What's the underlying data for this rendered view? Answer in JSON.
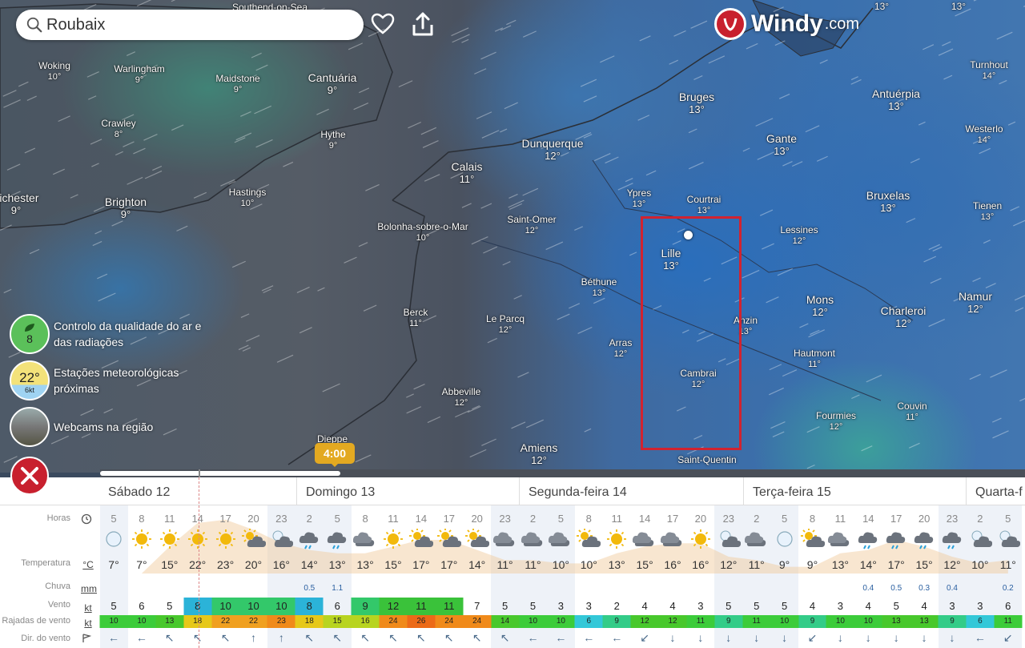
{
  "search": {
    "value": "Roubaix"
  },
  "logo": {
    "name": "Windy",
    "domain": ".com"
  },
  "cities": [
    {
      "name": "Southend-on-Sea",
      "temp": ""
    },
    {
      "name": "Woking",
      "temp": "10°"
    },
    {
      "name": "Warlingham",
      "temp": "9°"
    },
    {
      "name": "Maidstone",
      "temp": "9°"
    },
    {
      "name": "Cantuária",
      "temp": "9°"
    },
    {
      "name": "Crawley",
      "temp": "8°"
    },
    {
      "name": "Hythe",
      "temp": "9°"
    },
    {
      "name": "nichester",
      "temp": "9°"
    },
    {
      "name": "Brighton",
      "temp": "9°"
    },
    {
      "name": "Hastings",
      "temp": "10°"
    },
    {
      "name": "Calais",
      "temp": "11°"
    },
    {
      "name": "Dunquerque",
      "temp": "12°"
    },
    {
      "name": "Bolonha-sobre-o-Mar",
      "temp": "10°"
    },
    {
      "name": "Saint-Omer",
      "temp": "12°"
    },
    {
      "name": "Ypres",
      "temp": "13°"
    },
    {
      "name": "Courtrai",
      "temp": "13°"
    },
    {
      "name": "Bruges",
      "temp": "13°"
    },
    {
      "name": "Gante",
      "temp": "13°"
    },
    {
      "name": "Antuérpia",
      "temp": "13°"
    },
    {
      "name": "Turnhout",
      "temp": "14°"
    },
    {
      "name": "Westerlo",
      "temp": "14°"
    },
    {
      "name": "Bruxelas",
      "temp": "13°"
    },
    {
      "name": "Tienen",
      "temp": "13°"
    },
    {
      "name": "Lessines",
      "temp": "12°"
    },
    {
      "name": "Lille",
      "temp": "13°"
    },
    {
      "name": "Béthune",
      "temp": "13°"
    },
    {
      "name": "Mons",
      "temp": "12°"
    },
    {
      "name": "Charleroi",
      "temp": "12°"
    },
    {
      "name": "Namur",
      "temp": "12°"
    },
    {
      "name": "Berck",
      "temp": "11°"
    },
    {
      "name": "Le Parcq",
      "temp": "12°"
    },
    {
      "name": "Arras",
      "temp": "12°"
    },
    {
      "name": "Anzin",
      "temp": "13°"
    },
    {
      "name": "Hautmont",
      "temp": "11°"
    },
    {
      "name": "Cambrai",
      "temp": "12°"
    },
    {
      "name": "Abbeville",
      "temp": "12°"
    },
    {
      "name": "Fourmies",
      "temp": "12°"
    },
    {
      "name": "Couvin",
      "temp": "11°"
    },
    {
      "name": "Amiens",
      "temp": "12°"
    },
    {
      "name": "Dieppe",
      "temp": ""
    },
    {
      "name": "Saint-Quentin",
      "temp": ""
    },
    {
      "name": "13°",
      "temp": ""
    },
    {
      "name": "13°",
      "temp": ""
    }
  ],
  "sidebar": {
    "air_quality": {
      "value": "8",
      "label": "Controlo da qualidade do ar e das radiações"
    },
    "stations": {
      "value": "22°",
      "sub": "6kt",
      "label": "Estações meteorológicas próximas"
    },
    "webcams": {
      "label": "Webcams na região"
    }
  },
  "timeline": {
    "current_time": "4:00",
    "progress": 0.26
  },
  "colors": {
    "accent": "#c8202e",
    "time_bubble": "#e3a921",
    "selection": "#d12330"
  },
  "forecast": {
    "days": [
      "Sábado 12",
      "Domingo 13",
      "Segunda-feira 14",
      "Terça-feira 15",
      "Quarta-f"
    ],
    "labels": {
      "hours": "Horas",
      "temperature": "Temperatura",
      "rain": "Chuva",
      "wind": "Vento",
      "gusts": "Rajadas de vento",
      "direction": "Dir. do vento"
    },
    "units": {
      "temperature": "°C",
      "rain": "mm",
      "wind": "kt",
      "gusts": "kt"
    },
    "hours": [
      "5",
      "8",
      "11",
      "14",
      "17",
      "20",
      "23",
      "2",
      "5",
      "8",
      "11",
      "14",
      "17",
      "20",
      "23",
      "2",
      "5",
      "8",
      "11",
      "14",
      "17",
      "20",
      "23",
      "2",
      "5",
      "8",
      "11",
      "14",
      "17",
      "20",
      "23",
      "2",
      "5"
    ],
    "icons": [
      "moon",
      "sun",
      "sun",
      "sun",
      "sun",
      "sun-cloud",
      "moon-cloud",
      "cloud-rain",
      "cloud-rain",
      "cloud",
      "sun",
      "sun-cloud",
      "sun-cloud",
      "sun-cloud",
      "cloud",
      "cloud",
      "cloud",
      "sun-cloud",
      "sun",
      "cloud",
      "cloud",
      "sun",
      "moon-cloud",
      "cloud",
      "moon",
      "sun-cloud",
      "cloud",
      "cloud-rain",
      "cloud-rain",
      "cloud-rain",
      "cloud-rain",
      "moon-cloud",
      "moon-cloud"
    ],
    "temps": [
      "7°",
      "7°",
      "15°",
      "22°",
      "23°",
      "20°",
      "16°",
      "14°",
      "13°",
      "13°",
      "15°",
      "17°",
      "17°",
      "14°",
      "11°",
      "11°",
      "10°",
      "10°",
      "13°",
      "15°",
      "16°",
      "16°",
      "12°",
      "11°",
      "9°",
      "9°",
      "13°",
      "14°",
      "17°",
      "15°",
      "12°",
      "10°",
      "11°"
    ],
    "rain": [
      "",
      "",
      "",
      "",
      "",
      "",
      "",
      "0.5",
      "1.1",
      "",
      "",
      "",
      "",
      "",
      "",
      "",
      "",
      "",
      "",
      "",
      "",
      "",
      "",
      "",
      "",
      "",
      "",
      "0.4",
      "0.5",
      "0.3",
      "0.4",
      "",
      "0.2"
    ],
    "wind": [
      "5",
      "6",
      "5",
      "8",
      "10",
      "10",
      "10",
      "8",
      "6",
      "9",
      "12",
      "11",
      "11",
      "7",
      "5",
      "5",
      "3",
      "3",
      "2",
      "4",
      "4",
      "3",
      "5",
      "5",
      "5",
      "4",
      "3",
      "4",
      "5",
      "4",
      "3",
      "3",
      "6"
    ],
    "gusts": [
      "10",
      "10",
      "13",
      "18",
      "22",
      "22",
      "23",
      "18",
      "15",
      "16",
      "24",
      "26",
      "24",
      "24",
      "14",
      "10",
      "10",
      "6",
      "9",
      "12",
      "12",
      "11",
      "9",
      "11",
      "10",
      "9",
      "10",
      "10",
      "13",
      "13",
      "9",
      "6",
      "11"
    ],
    "directions": [
      "←",
      "←",
      "↖",
      "↖",
      "↖",
      "↑",
      "↑",
      "↖",
      "↖",
      "↖",
      "↖",
      "↖",
      "↖",
      "↖",
      "↖",
      "←",
      "←",
      "←",
      "←",
      "↙",
      "↓",
      "↓",
      "↓",
      "↓",
      "↓",
      "↙",
      "↓",
      "↓",
      "↓",
      "↓",
      "↓",
      "←",
      "↙"
    ]
  }
}
